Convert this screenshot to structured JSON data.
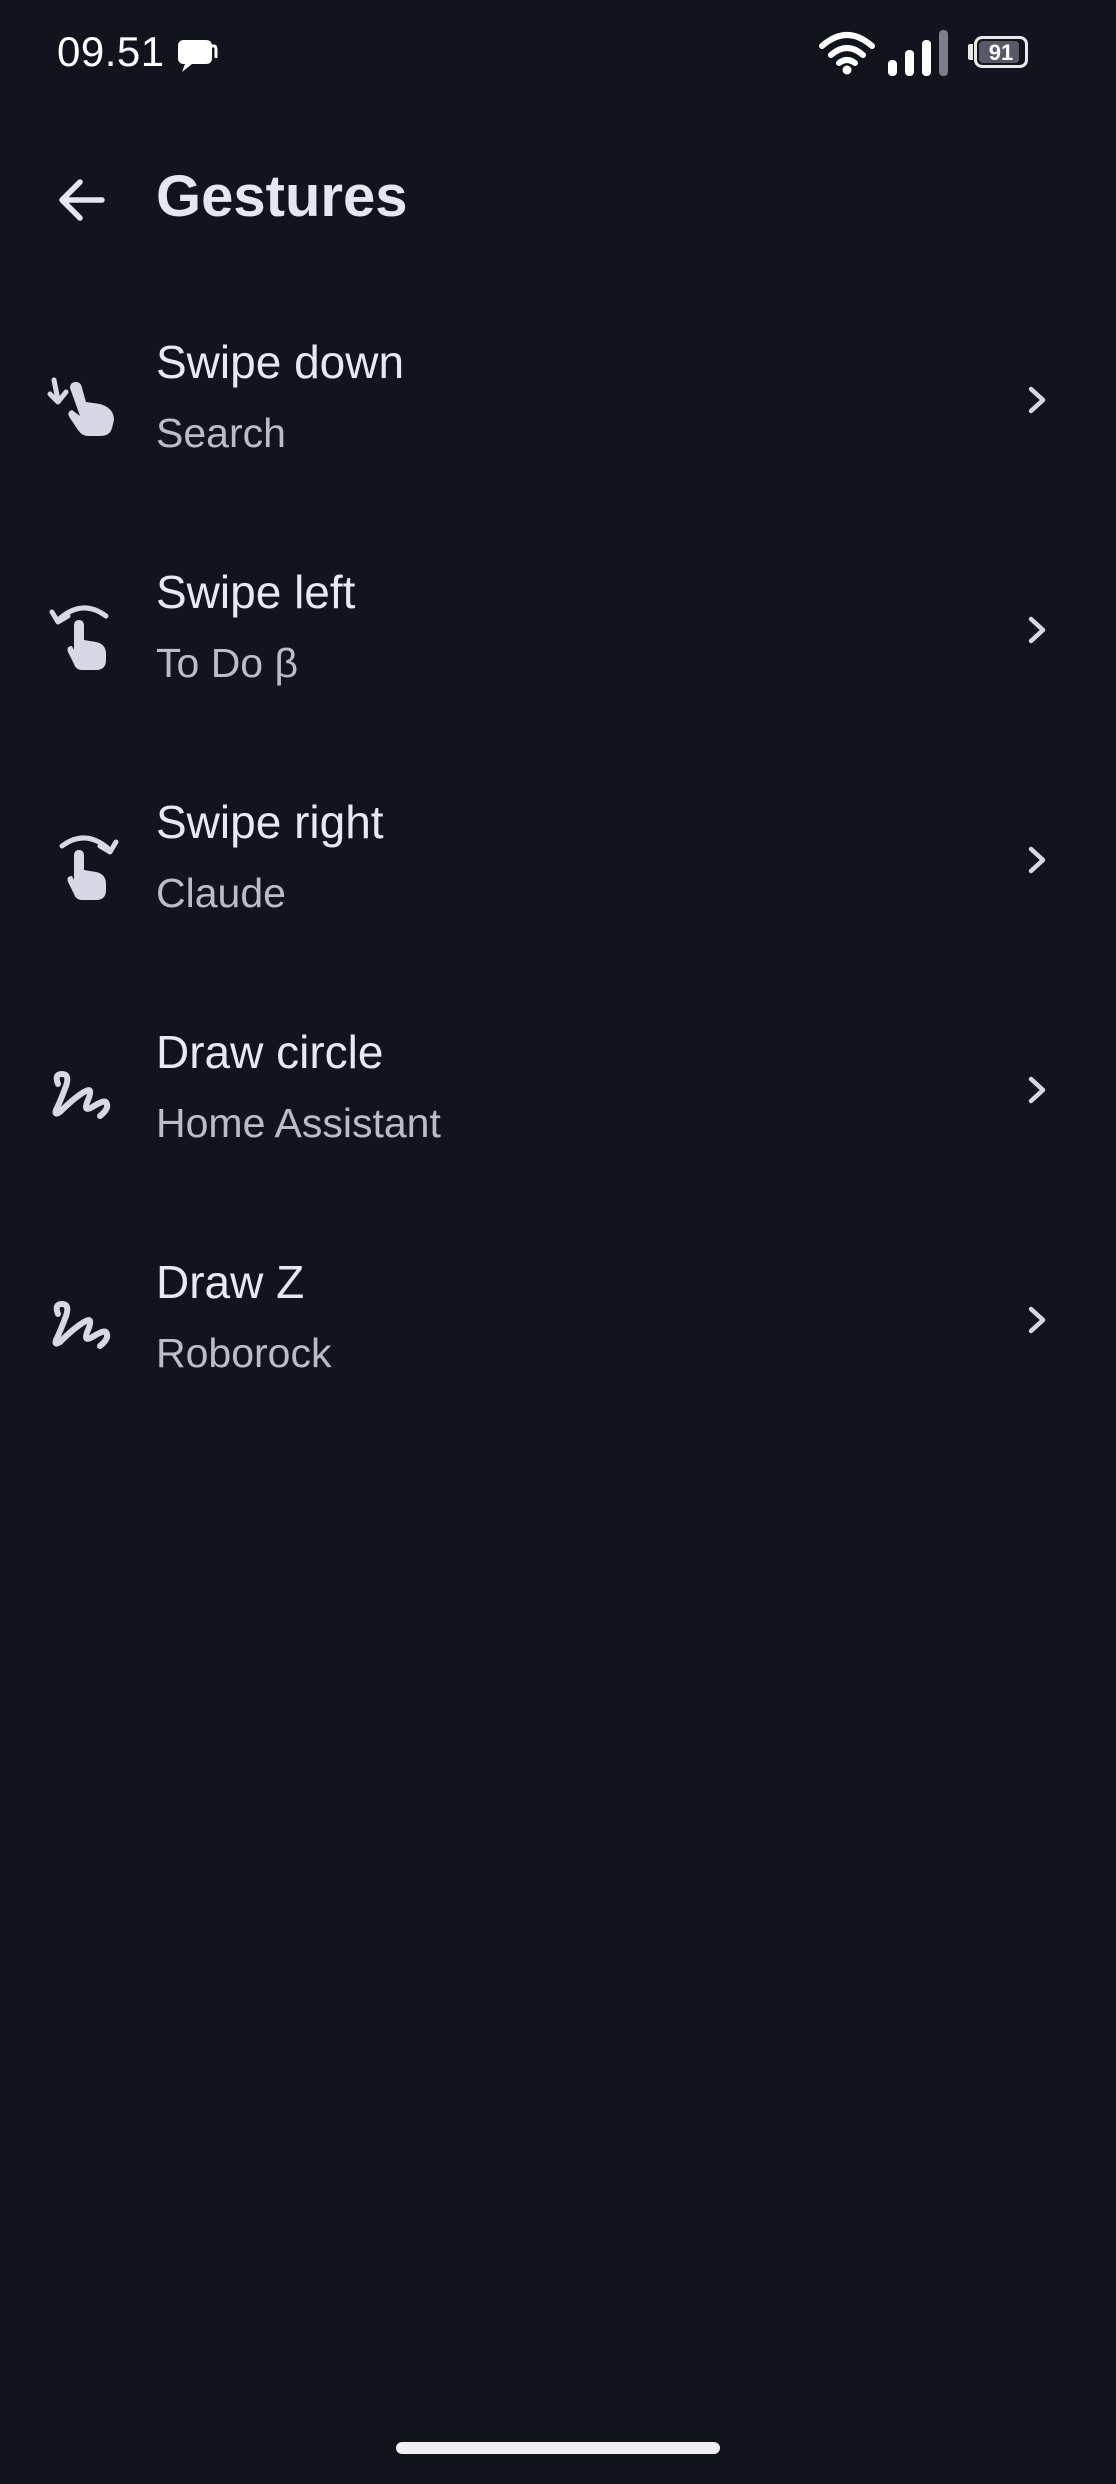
{
  "status_bar": {
    "time": "09.51",
    "battery_level": "91",
    "battery_fraction": 0.91
  },
  "header": {
    "title": "Gestures",
    "back_icon": "arrow-back-icon"
  },
  "gestures": [
    {
      "title": "Swipe down",
      "action": "Search",
      "icon": "swipe-down-icon"
    },
    {
      "title": "Swipe left",
      "action": "To Do β",
      "icon": "swipe-left-icon"
    },
    {
      "title": "Swipe right",
      "action": "Claude",
      "icon": "swipe-right-icon"
    },
    {
      "title": "Draw circle",
      "action": "Home Assistant",
      "icon": "draw-gesture-icon"
    },
    {
      "title": "Draw Z",
      "action": "Roborock",
      "icon": "draw-gesture-icon"
    }
  ],
  "colors": {
    "background": "#11141d",
    "text_primary": "#e6e8f2",
    "text_secondary": "#b9bdcb",
    "icon": "#d6d8e6"
  }
}
